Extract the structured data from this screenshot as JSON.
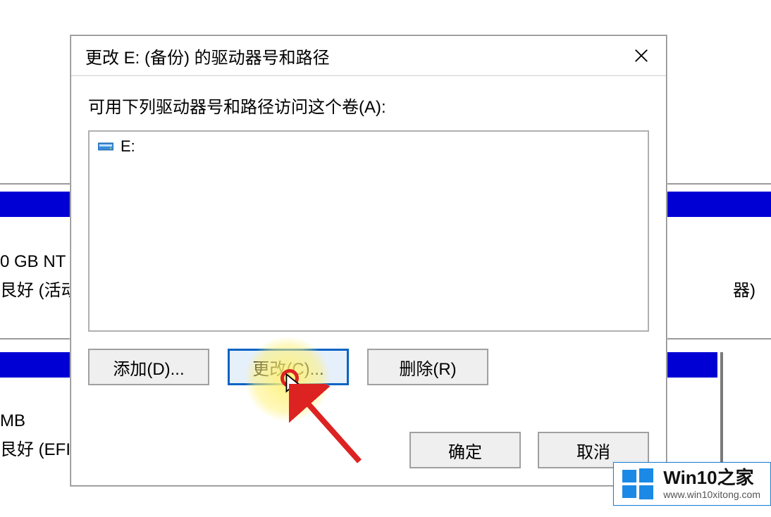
{
  "dialog": {
    "title": "更改 E: (备份) 的驱动器号和路径",
    "instruction": "可用下列驱动器号和路径访问这个卷(A):",
    "list_item_label": "E:",
    "buttons": {
      "add": "添加(D)...",
      "change": "更改(C)...",
      "remove": "删除(R)"
    },
    "ok": "确定",
    "cancel": "取消"
  },
  "background": {
    "line1a": "0 GB NT",
    "line1b": "艮好 (活动",
    "right1_fragment": "器)",
    "line2a": "MB",
    "line2b": "艮好 (EFI 系"
  },
  "watermark": {
    "title": "Win10之家",
    "url": "www.win10xitong.com"
  }
}
